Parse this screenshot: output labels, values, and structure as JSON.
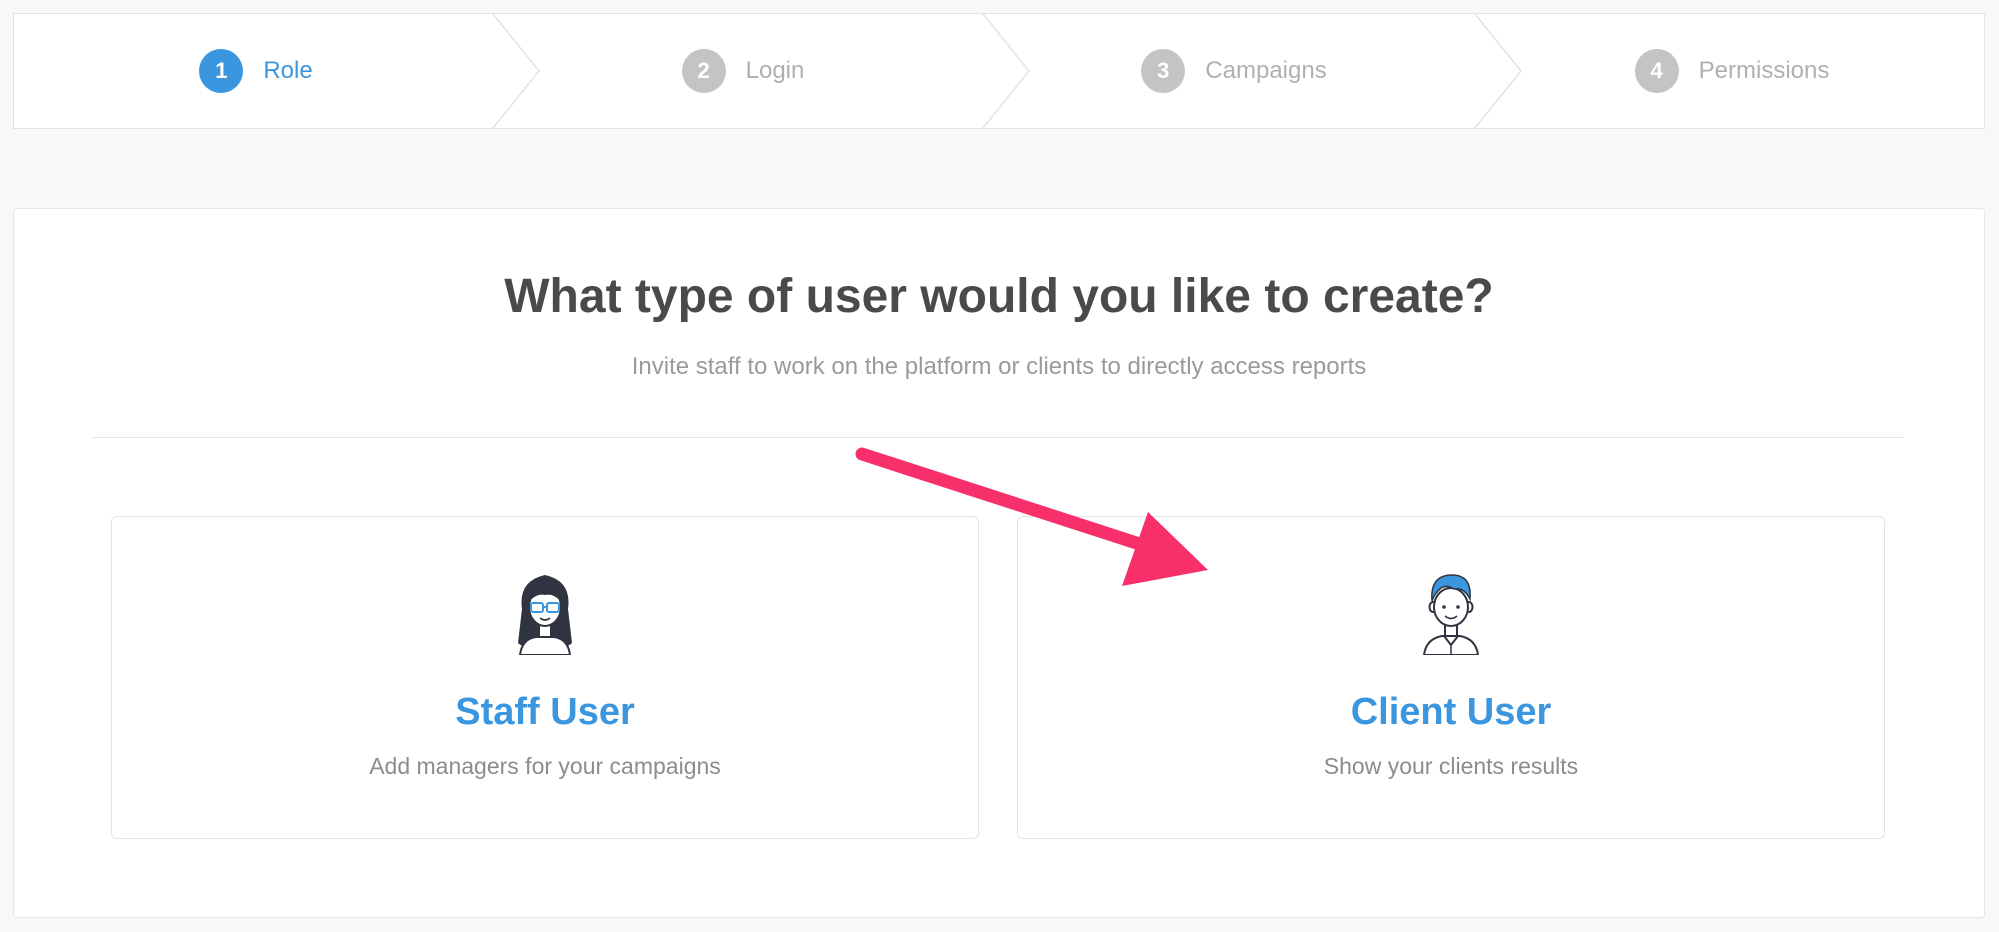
{
  "stepper": {
    "steps": [
      {
        "number": "1",
        "label": "Role",
        "active": true
      },
      {
        "number": "2",
        "label": "Login",
        "active": false
      },
      {
        "number": "3",
        "label": "Campaigns",
        "active": false
      },
      {
        "number": "4",
        "label": "Permissions",
        "active": false
      }
    ]
  },
  "main": {
    "title": "What type of user would you like to create?",
    "subtitle": "Invite staff to work on the platform or clients to directly access reports",
    "cards": {
      "staff": {
        "title": "Staff User",
        "description": "Add managers for your campaigns",
        "icon": "female-avatar-icon"
      },
      "client": {
        "title": "Client User",
        "description": "Show your clients results",
        "icon": "male-avatar-icon"
      }
    }
  },
  "colors": {
    "accent": "#3b96e0",
    "inactive": "#c4c4c4",
    "annotation_arrow": "#f7306c"
  }
}
